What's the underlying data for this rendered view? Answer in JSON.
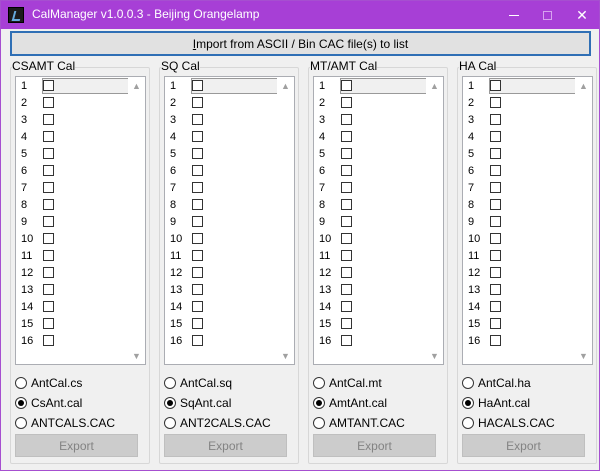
{
  "window": {
    "title": "CalManager v1.0.0.3 - Beijing Orangelamp",
    "controls": {
      "minimize": "minimize-icon",
      "maximize": "maximize-icon",
      "close": "✕"
    }
  },
  "import_button": {
    "label_first": "I",
    "label_rest": "mport from ASCII / Bin CAC file(s) to list"
  },
  "row_numbers": [
    "1",
    "2",
    "3",
    "4",
    "5",
    "6",
    "7",
    "8",
    "9",
    "10",
    "11",
    "12",
    "13",
    "14",
    "15",
    "16"
  ],
  "scroll": {
    "up": "▲",
    "down": "▼"
  },
  "groups": [
    {
      "title": "CSAMT Cal",
      "radios": [
        "AntCal.cs",
        "CsAnt.cal",
        "ANTCALS.CAC"
      ],
      "selected": 1,
      "export": "Export"
    },
    {
      "title": "SQ Cal",
      "radios": [
        "AntCal.sq",
        "SqAnt.cal",
        "ANT2CALS.CAC"
      ],
      "selected": 1,
      "export": "Export"
    },
    {
      "title": "MT/AMT Cal",
      "radios": [
        "AntCal.mt",
        "AmtAnt.cal",
        "AMTANT.CAC"
      ],
      "selected": 1,
      "export": "Export"
    },
    {
      "title": "HA Cal",
      "radios": [
        "AntCal.ha",
        "HaAnt.cal",
        "HACALS.CAC"
      ],
      "selected": 1,
      "export": "Export"
    }
  ]
}
